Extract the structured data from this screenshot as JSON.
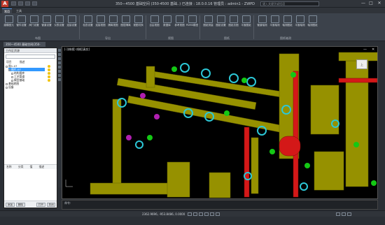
{
  "app": {
    "logo": "A",
    "title": "350—4500 基础空间 (350-4500 基础..) 已连接 : 18.0.0.16 管理员 : admin1 - ZWPD",
    "search_placeholder": "键入关键字或短语",
    "win_min": "—",
    "win_max": "□",
    "win_close": "✕"
  },
  "tabs": [
    "常用",
    "工具"
  ],
  "ribbon": {
    "buttons": [
      "建模图元",
      "管件设置",
      "阀门设置",
      "管道设置",
      "仪表设置",
      "连接设置",
      "检查设置",
      "连接视图",
      "隔离视图",
      "图层隔离",
      "视图切换",
      "自由视图",
      "数据库",
      "参考视图",
      "PDMS模型",
      "图纸测量",
      "图纸设置",
      "图纸总图",
      "平面图纸",
      "管道轴测",
      "平面轴测",
      "轴测图纸",
      "平面轴测",
      "轴测图纸"
    ],
    "groups": [
      "布图",
      "导出",
      "视图",
      "图纸",
      "图纸轴测"
    ]
  },
  "doc_tab": "350—4500 基础空间(350-",
  "left_panel": {
    "header": "工作区资源",
    "columns": [
      "项目",
      "描述"
    ],
    "tree": [
      "图1-07",
      "图片-07",
      "结构图库",
      "工艺管道",
      "模型基础",
      "基础底图",
      "设备"
    ],
    "lower_columns": [
      "名称",
      "分类",
      "值",
      "描述"
    ],
    "footer_buttons": [
      "添加",
      "删除",
      "打开",
      "关闭"
    ]
  },
  "viewport": {
    "label": "[-](俯视) 线框[真实]",
    "min_label": "—",
    "close_label": "✕",
    "view_cube": "上"
  },
  "command": {
    "prompt": "命令:"
  },
  "status": {
    "coords": "2362.9696, -953.8486, 0.0000"
  }
}
